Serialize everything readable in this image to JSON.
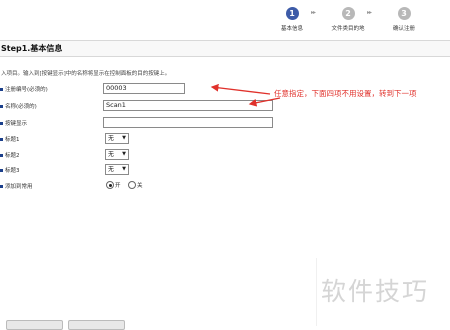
{
  "steps": [
    {
      "num": "1",
      "label": "基本信息",
      "color": "#3d5ba8"
    },
    {
      "num": "2",
      "label": "文件类目的地",
      "color": "#b8b8b8"
    },
    {
      "num": "3",
      "label": "确认注册",
      "color": "#b8b8b8"
    }
  ],
  "step_arrow": "▸▸",
  "page_title": "Step1.基本信息",
  "description": "入项目。输入到[按键显示]中的名称将显示在控制面板的目的按键上。",
  "fields": {
    "reg_no": {
      "label": "注册编号(必须的)",
      "value": "00003"
    },
    "name": {
      "label": "名称(必须的)",
      "value": "Scan1"
    },
    "key_display": {
      "label": "按键显示",
      "value": ""
    },
    "tag1": {
      "label": "标题1",
      "value": "无"
    },
    "tag2": {
      "label": "标题2",
      "value": "无"
    },
    "tag3": {
      "label": "标题3",
      "value": "无"
    },
    "freq": {
      "label": "添加到常用",
      "on": "开",
      "off": "关"
    }
  },
  "annotation": "任意指定，下面四项不用设置，转到下一项",
  "annotation_color": "#e0312b",
  "watermark": "软件技巧"
}
